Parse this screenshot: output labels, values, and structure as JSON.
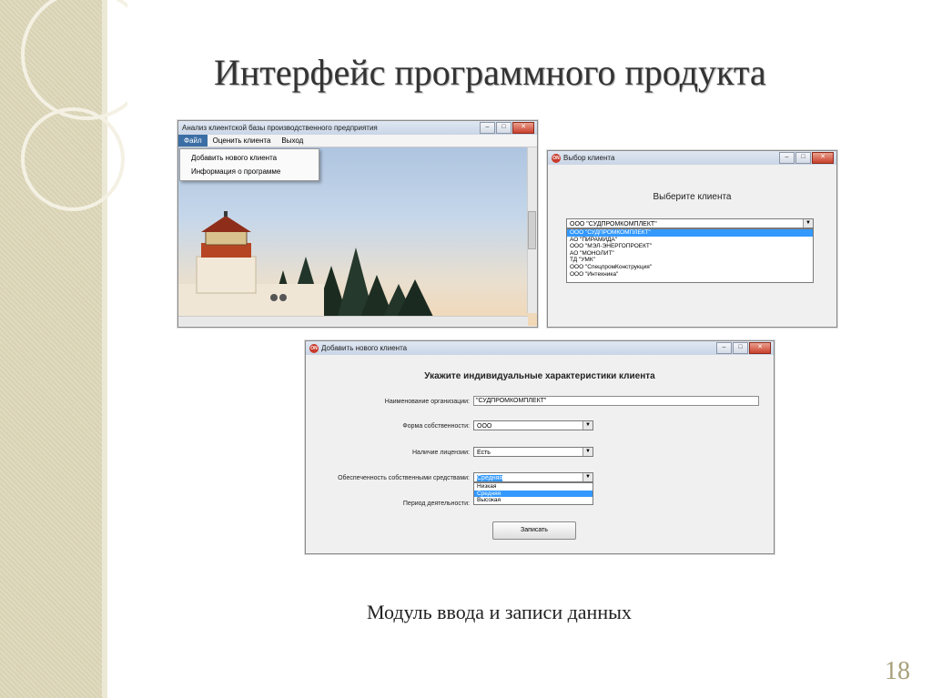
{
  "slide": {
    "title": "Интерфейс программного продукта",
    "caption": "Модуль ввода и записи данных",
    "page_number": "18"
  },
  "icons": {
    "window_icon": "app-logo-icon",
    "minimize": "minimize-icon",
    "maximize": "maximize-icon",
    "close": "close-icon",
    "dropdown_arrow": "chevron-down-icon"
  },
  "main_window": {
    "title": "Анализ клиентской базы производственного предприятия",
    "menu": [
      "Файл",
      "Оценить клиента",
      "Выход"
    ],
    "file_menu_items": [
      "Добавить нового клиента",
      "Информация о программе"
    ]
  },
  "select_client_window": {
    "title": "Выбор клиента",
    "heading": "Выберите клиента",
    "combo_value": "ООО \"СУДПРОМКОМПЛЕКТ\"",
    "options": [
      "ООО \"СУДПРОМКОМПЛЕКТ\"",
      "АО \"ПИРАМИДА\"",
      "ООО \"МЭЛ-ЭНЕРГОПРОЕКТ\"",
      "АО \"МОНОЛИТ\"",
      "ТД \"УМК\"",
      "ООО \"СпецпромКонструкция\"",
      "ООО \"Интехника\""
    ],
    "selected_index": 0
  },
  "add_client_window": {
    "title": "Добавить нового клиента",
    "heading": "Укажите индивидуальные характеристики клиента",
    "fields": {
      "org_name": {
        "label": "Наименование организации:",
        "value": "\"СУДПРОМКОМПЛЕКТ\""
      },
      "ownership": {
        "label": "Форма собственности:",
        "value": "ООО"
      },
      "license": {
        "label": "Наличие лицензии:",
        "value": "Есть"
      },
      "own_funds": {
        "label": "Обеспеченность собственными средствами:",
        "value": "Средняя"
      },
      "period": {
        "label": "Период деятельности:"
      }
    },
    "own_funds_options": [
      "Низкая",
      "Средняя",
      "Высокая"
    ],
    "own_funds_selected_index": 1,
    "save_button": "Записать"
  }
}
